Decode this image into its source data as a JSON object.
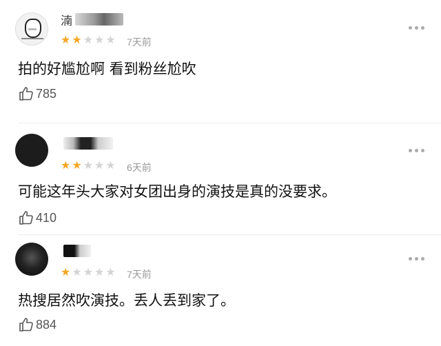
{
  "comments": [
    {
      "username": "湳",
      "stars_filled": 2,
      "stars_total": 5,
      "time": "7天前",
      "text": "拍的好尴尬啊 看到粉丝尬吹",
      "likes": "785"
    },
    {
      "username": "",
      "stars_filled": 2,
      "stars_total": 5,
      "time": "6天前",
      "text": "可能这年头大家对女团出身的演技是真的没要求。",
      "likes": "410"
    },
    {
      "username": "",
      "stars_filled": 1,
      "stars_total": 5,
      "time": "7天前",
      "text": "热搜居然吹演技。丢人丢到家了。",
      "likes": "884"
    }
  ],
  "colors": {
    "star_on": "#f5a623",
    "star_off": "#d4d4d4",
    "meta": "#999999"
  },
  "icons": {
    "like": "thumbs-up-icon",
    "more": "more-dots-icon"
  }
}
